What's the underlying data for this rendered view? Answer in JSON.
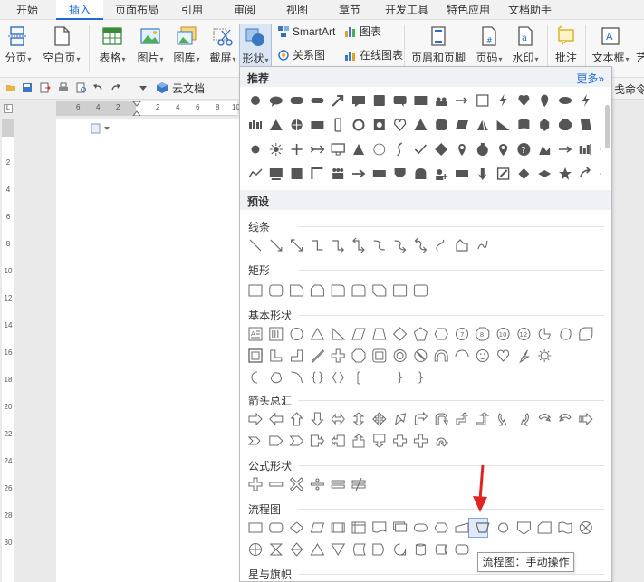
{
  "tabs": [
    {
      "label": "开始"
    },
    {
      "label": "插入"
    },
    {
      "label": "页面布局"
    },
    {
      "label": "引用"
    },
    {
      "label": "审阅"
    },
    {
      "label": "视图"
    },
    {
      "label": "章节"
    },
    {
      "label": "开发工具"
    },
    {
      "label": "特色应用"
    },
    {
      "label": "文档助手"
    }
  ],
  "active_tab": "插入",
  "ribbon": {
    "page": "分页",
    "blank_page": "空白页",
    "table": "表格",
    "picture": "图片",
    "gallery": "图库",
    "screenshot": "截屏",
    "shapes": "形状",
    "smartart": "SmartArt",
    "icons": "图表",
    "relation": "关系图",
    "online_chart": "在线图表",
    "header_footer": "页眉和页脚",
    "page_number": "页码",
    "watermark": "水印",
    "comment": "批注",
    "textbox": "文本框",
    "more_cut": "艺",
    "cmd_hint": "戋命令、"
  },
  "quick": {
    "cloud_doc": "云文档"
  },
  "ruler": {
    "h_numbers": [
      "6",
      "4",
      "2",
      "2",
      "4",
      "6",
      "8",
      "10"
    ],
    "v_numbers": [
      "2",
      "4",
      "6",
      "8",
      "10",
      "12",
      "14",
      "16",
      "18",
      "20",
      "22",
      "24",
      "26",
      "28",
      "30"
    ]
  },
  "panel": {
    "recommended_header": "推荐",
    "more_link": "更多»",
    "preset_header": "预设",
    "sections": [
      {
        "id": "lines",
        "label": "线条"
      },
      {
        "id": "rect",
        "label": "矩形"
      },
      {
        "id": "basic",
        "label": "基本形状"
      },
      {
        "id": "arrows",
        "label": "箭头总汇"
      },
      {
        "id": "formula",
        "label": "公式形状"
      },
      {
        "id": "flowchart",
        "label": "流程图"
      },
      {
        "id": "stars",
        "label": "星与旗帜"
      }
    ]
  },
  "tooltip": "流程图：手动操作",
  "colors": {
    "accent": "#1d6cd6",
    "icon_gray": "#555555",
    "outline": "#6b6b6b",
    "arrow_red": "#e02424"
  }
}
